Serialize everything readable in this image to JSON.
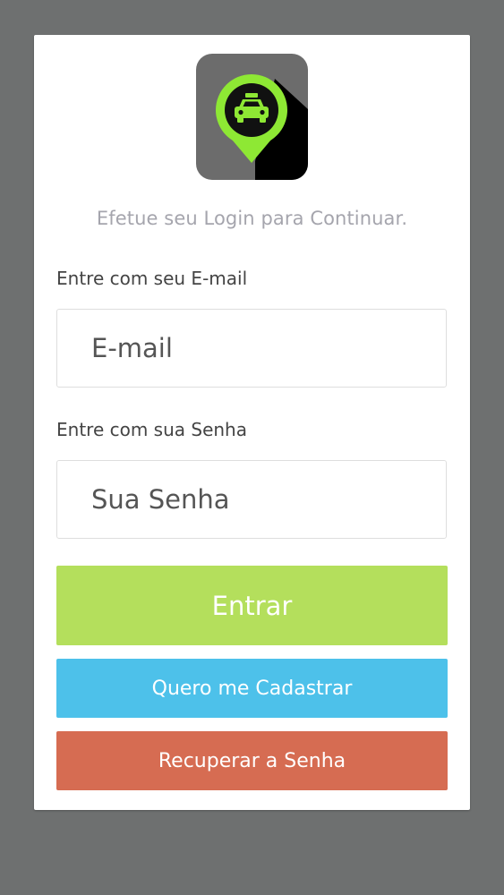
{
  "login": {
    "subtitle": "Efetue seu Login para Continuar.",
    "email_label": "Entre com seu E-mail",
    "email_placeholder": "E-mail",
    "password_label": "Entre com sua Senha",
    "password_placeholder": "Sua Senha",
    "login_button": "Entrar",
    "register_button": "Quero me Cadastrar",
    "recover_button": "Recuperar a Senha"
  },
  "logo": {
    "icon": "taxi-location-pin-icon"
  },
  "colors": {
    "background": "#6e7070",
    "card": "#ffffff",
    "logo_bg": "#6c6c6c",
    "logo_accent": "#8ee834",
    "login_button": "#b4df5c",
    "register_button": "#4dc1ea",
    "recover_button": "#d66c52",
    "subtitle_text": "#a5a5ad",
    "label_text": "#444444"
  }
}
